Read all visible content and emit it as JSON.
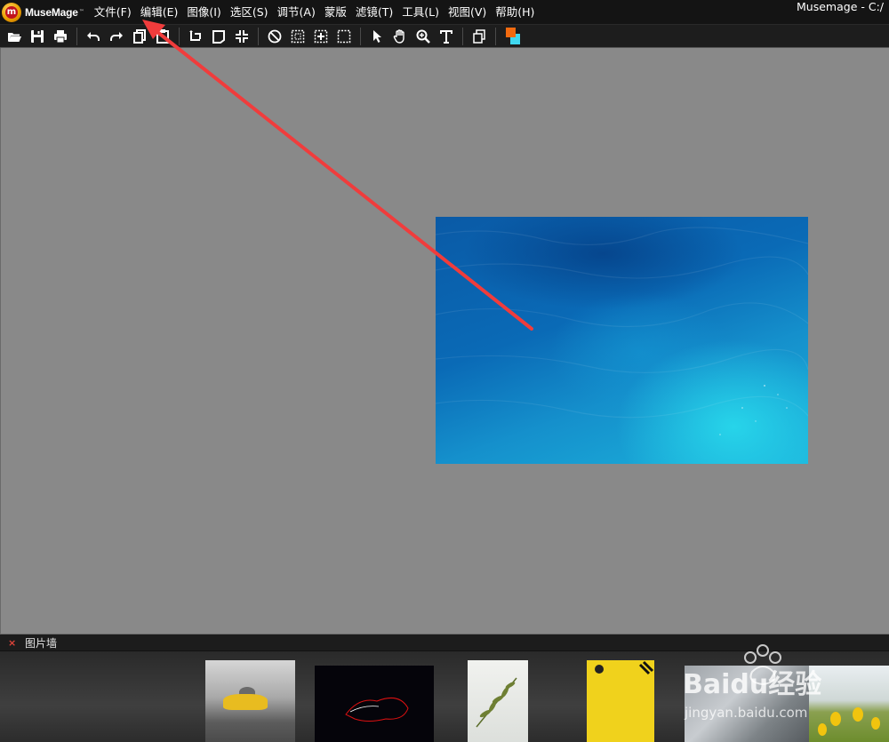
{
  "app": {
    "logo_text": "MuseMage",
    "logo_tm": "™",
    "window_title": "Musemage - C:/"
  },
  "menu": [
    {
      "label": "文件(F)"
    },
    {
      "label": "编辑(E)"
    },
    {
      "label": "图像(I)"
    },
    {
      "label": "选区(S)"
    },
    {
      "label": "调节(A)"
    },
    {
      "label": "蒙版"
    },
    {
      "label": "滤镜(T)"
    },
    {
      "label": "工具(L)"
    },
    {
      "label": "视图(V)"
    },
    {
      "label": "帮助(H)"
    }
  ],
  "toolbar": {
    "icons": [
      "open-folder-icon",
      "save-icon",
      "print-icon",
      "undo-icon",
      "redo-icon",
      "copy-icon",
      "paste-icon",
      "rotate-icon",
      "crop-icon",
      "fit-icon",
      "cancel-selection-icon",
      "select-rect-icon",
      "select-move-icon",
      "select-invert-icon",
      "pointer-icon",
      "hand-icon",
      "zoom-icon",
      "text-icon",
      "layers-icon",
      "color-swatch"
    ],
    "foreground_color": "#f26a0f",
    "background_color": "#3fd8f0"
  },
  "photowall": {
    "close_symbol": "×",
    "title": "图片墙"
  },
  "watermark": {
    "brand": "Baidu经验",
    "url": "jingyan.baidu.com"
  },
  "colors": {
    "annotation_arrow": "#f03c3c",
    "canvas_bg": "#898989"
  }
}
